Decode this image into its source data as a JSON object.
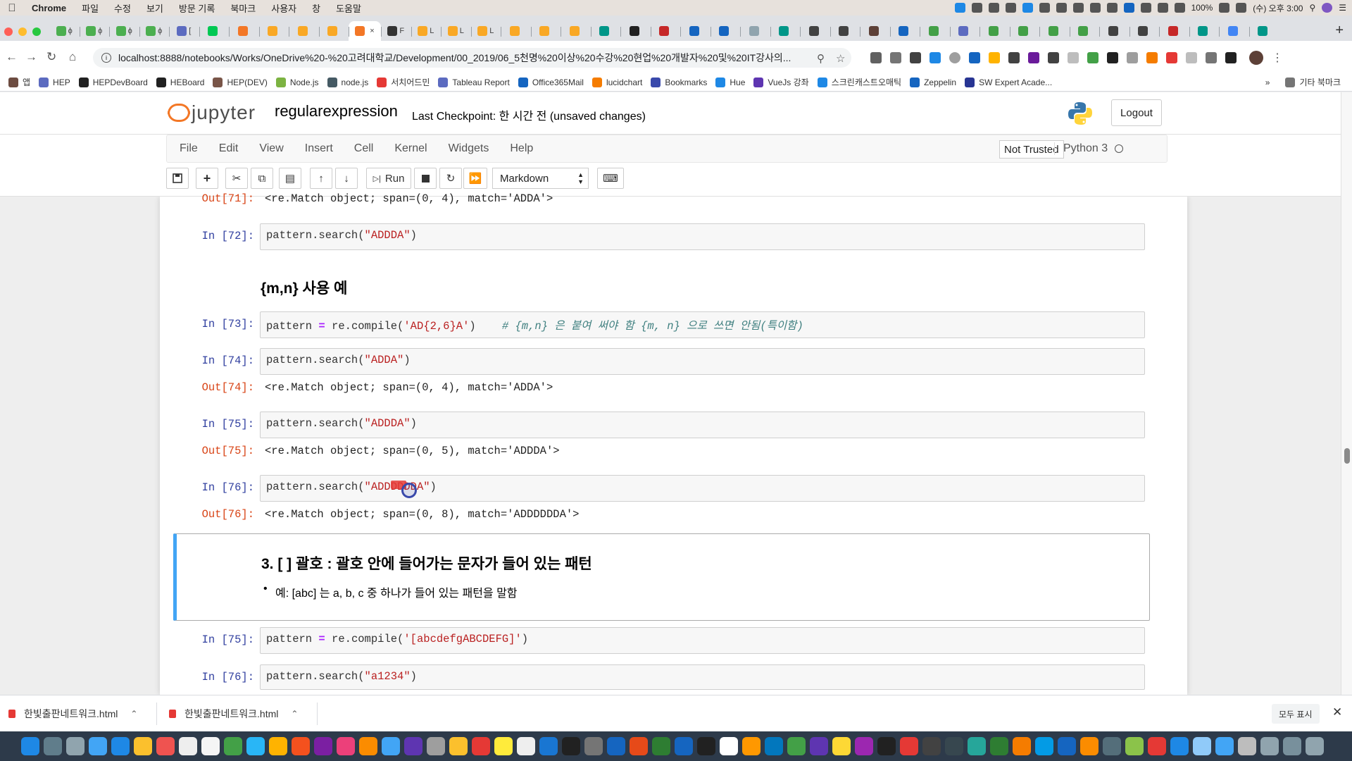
{
  "menubar": {
    "app": "Chrome",
    "items": [
      "파일",
      "수정",
      "보기",
      "방문 기록",
      "북마크",
      "사용자",
      "창",
      "도움말"
    ],
    "battery": "100%",
    "clock": "(수) 오후 3:00"
  },
  "tabs": [
    {
      "label": "ϕ",
      "color": "#4caf50"
    },
    {
      "label": "ϕ",
      "color": "#4caf50"
    },
    {
      "label": "ϕ",
      "color": "#4caf50"
    },
    {
      "label": "ϕ",
      "color": "#4caf50"
    },
    {
      "label": "[",
      "color": "#5c6bc0"
    },
    {
      "label": "",
      "color": "#00c853"
    },
    {
      "label": "",
      "color": "#f37726"
    },
    {
      "label": "",
      "color": "#f9a825"
    },
    {
      "label": "",
      "color": "#f9a825"
    },
    {
      "label": "",
      "color": "#f9a825"
    },
    {
      "label": "",
      "color": "#f37726",
      "active": true
    },
    {
      "label": "F",
      "color": "#333333"
    },
    {
      "label": "L",
      "color": "#f9a825"
    },
    {
      "label": "L",
      "color": "#f9a825"
    },
    {
      "label": "L",
      "color": "#f9a825"
    },
    {
      "label": "",
      "color": "#f9a825"
    },
    {
      "label": "",
      "color": "#f9a825"
    },
    {
      "label": "",
      "color": "#f9a825"
    },
    {
      "label": "",
      "color": "#009688"
    },
    {
      "label": "",
      "color": "#212121"
    },
    {
      "label": "",
      "color": "#c62828"
    },
    {
      "label": "",
      "color": "#1565c0"
    },
    {
      "label": "",
      "color": "#1565c0"
    },
    {
      "label": "",
      "color": "#90a4ae"
    },
    {
      "label": "",
      "color": "#009688"
    },
    {
      "label": "",
      "color": "#424242"
    },
    {
      "label": "",
      "color": "#424242"
    },
    {
      "label": "",
      "color": "#5d4037"
    },
    {
      "label": "",
      "color": "#1565c0"
    },
    {
      "label": "",
      "color": "#43a047"
    },
    {
      "label": "",
      "color": "#5c6bc0"
    },
    {
      "label": "",
      "color": "#43a047"
    },
    {
      "label": "",
      "color": "#43a047"
    },
    {
      "label": "",
      "color": "#43a047"
    },
    {
      "label": "",
      "color": "#43a047"
    },
    {
      "label": "",
      "color": "#424242"
    },
    {
      "label": "",
      "color": "#424242"
    },
    {
      "label": "",
      "color": "#c62828"
    },
    {
      "label": "",
      "color": "#009688"
    },
    {
      "label": "",
      "color": "#4285f4"
    },
    {
      "label": "",
      "color": "#009688"
    }
  ],
  "url": "localhost:8888/notebooks/Works/OneDrive%20-%20고려대학교/Development/00_2019/06_5천명%20이상%20수강%20현업%20개발자%20및%20IT강사의...",
  "bookmarks": [
    {
      "label": "앱",
      "color": "#6d4c41"
    },
    {
      "label": "HEP",
      "color": "#5c6bc0"
    },
    {
      "label": "HEPDevBoard",
      "color": "#212121"
    },
    {
      "label": "HEBoard",
      "color": "#212121"
    },
    {
      "label": "HEP(DEV)",
      "color": "#795548"
    },
    {
      "label": "Node.js",
      "color": "#7cb342"
    },
    {
      "label": "node.js",
      "color": "#455a64"
    },
    {
      "label": "서치어드민",
      "color": "#e53935"
    },
    {
      "label": "Tableau Report",
      "color": "#5c6bc0"
    },
    {
      "label": "Office365Mail",
      "color": "#1565c0"
    },
    {
      "label": "lucidchart",
      "color": "#f57c00"
    },
    {
      "label": "Bookmarks",
      "color": "#3949ab"
    },
    {
      "label": "Hue",
      "color": "#1e88e5"
    },
    {
      "label": "VueJs 강좌",
      "color": "#5e35b1"
    },
    {
      "label": "스크린캐스트오매틱",
      "color": "#1e88e5"
    },
    {
      "label": "Zeppelin",
      "color": "#1565c0"
    },
    {
      "label": "SW Expert Acade...",
      "color": "#283593"
    }
  ],
  "bookmarks_more": "»",
  "other_bookmarks": "기타 북마크",
  "jupyter": {
    "brand": "jupyter",
    "notebook_name": "regularexpression",
    "checkpoint": "Last Checkpoint: 한 시간 전  (unsaved changes)",
    "logout": "Logout",
    "menu": [
      "File",
      "Edit",
      "View",
      "Insert",
      "Cell",
      "Kernel",
      "Widgets",
      "Help"
    ],
    "not_trusted": "Not Trusted",
    "kernel": "Python 3",
    "run_label": "Run",
    "cell_type": "Markdown"
  },
  "cells": {
    "out71": {
      "prompt": "Out[71]:",
      "text": "<re.Match object; span=(0, 4), match='ADDA'>"
    },
    "in72": {
      "prompt": "In [72]:",
      "fn": "pattern.search(",
      "arg": "\"ADDDA\"",
      "close": ")"
    },
    "md_mn": "{m,n} 사용 예",
    "in73": {
      "prompt": "In [73]:",
      "lhs": "pattern ",
      "op": "=",
      "mid": " re.compile(",
      "arg": "'AD{2,6}A'",
      "close": ")",
      "comment": "# {m,n} 은 붙여 써야 함 {m, n} 으로 쓰면 안됨(특이함)"
    },
    "in74": {
      "prompt": "In [74]:",
      "fn": "pattern.search(",
      "arg": "\"ADDA\"",
      "close": ")"
    },
    "out74": {
      "prompt": "Out[74]:",
      "text": "<re.Match object; span=(0, 4), match='ADDA'>"
    },
    "in75": {
      "prompt": "In [75]:",
      "fn": "pattern.search(",
      "arg": "\"ADDDA\"",
      "close": ")"
    },
    "out75": {
      "prompt": "Out[75]:",
      "text": "<re.Match object; span=(0, 5), match='ADDDA'>"
    },
    "in76": {
      "prompt": "In [76]:",
      "fn": "pattern.search(",
      "arg": "\"ADDDDDDA\"",
      "close": ")"
    },
    "out76": {
      "prompt": "Out[76]:",
      "text": "<re.Match object; span=(0, 8), match='ADDDDDDA'>"
    },
    "md3_heading": "3. [ ] 괄호 : 괄호 안에 들어가는 문자가 들어 있는 패턴",
    "md3_bullet": "예: [abc] 는 a, b, c 중 하나가 들어 있는 패턴을 말함",
    "in75b": {
      "prompt": "In [75]:",
      "lhs": "pattern ",
      "op": "=",
      "mid": " re.compile(",
      "arg": "'[abcdefgABCDEFG]'",
      "close": ")"
    },
    "in76b": {
      "prompt": "In [76]:",
      "fn": "pattern.search(",
      "arg": "\"a1234\"",
      "close": ")"
    }
  },
  "downloads": [
    {
      "name": "한빛출판네트워크.html"
    },
    {
      "name": "한빛출판네트워크.html"
    }
  ],
  "show_all": "모두 표시",
  "dock_colors": [
    "#1e88e5",
    "#607d8b",
    "#90a4ae",
    "#42a5f5",
    "#1e88e5",
    "#fbc02d",
    "#ef5350",
    "#eeeeee",
    "#f5f5f5",
    "#43a047",
    "#29b6f6",
    "#ffb300",
    "#f4511e",
    "#7b1fa2",
    "#ec407a",
    "#fb8c00",
    "#42a5f5",
    "#5e35b1",
    "#9e9e9e",
    "#fbc02d",
    "#e53935",
    "#ffeb3b",
    "#eeeeee",
    "#1976d2",
    "#212121",
    "#757575",
    "#1565c0",
    "#e64a19",
    "#2e7d32",
    "#1565c0",
    "#212121",
    "#ffffff",
    "#ff9800",
    "#0277bd",
    "#43a047",
    "#5e35b1",
    "#fdd835",
    "#9c27b0",
    "#212121",
    "#e53935",
    "#424242",
    "#37474f",
    "#26a69a",
    "#2e7d32",
    "#f57c00",
    "#039be5",
    "#1565c0",
    "#fb8c00",
    "#546e7a",
    "#8bc34a",
    "#e53935",
    "#1e88e5",
    "#90caf9",
    "#42a5f5",
    "#bdbdbd",
    "#90a4ae",
    "#78909c",
    "#90a4ae"
  ]
}
